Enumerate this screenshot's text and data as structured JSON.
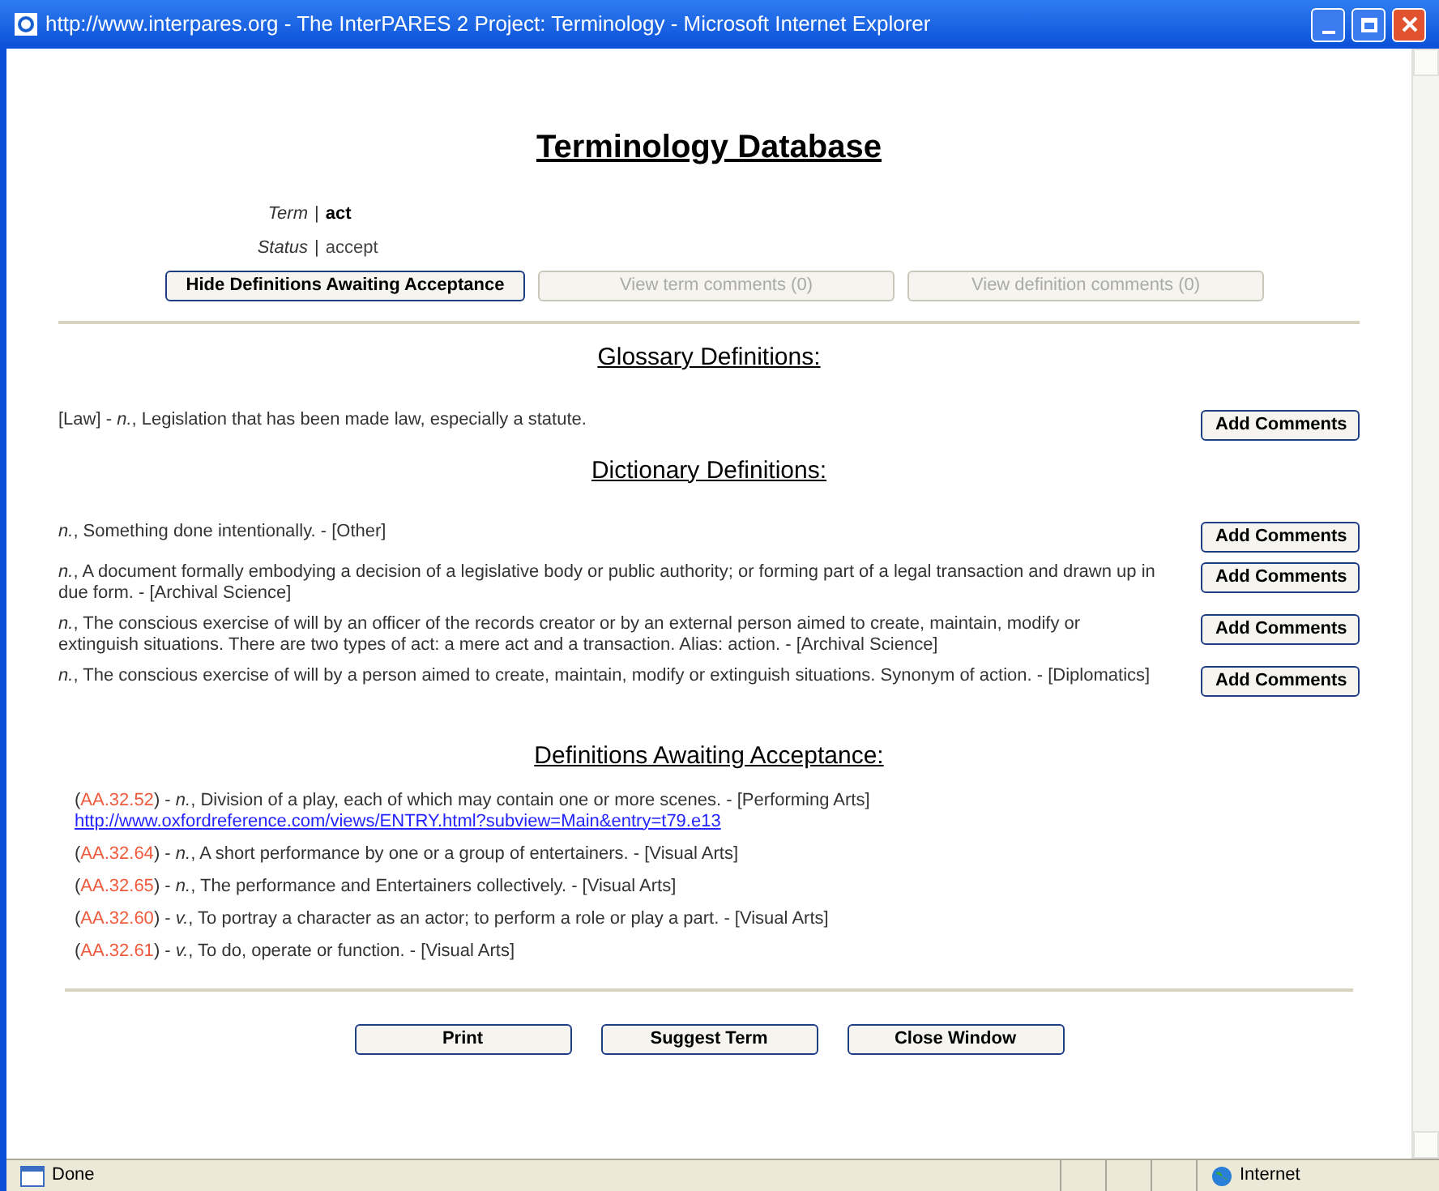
{
  "window": {
    "title": "http://www.interpares.org - The InterPARES 2 Project: Terminology - Microsoft Internet Explorer"
  },
  "page_title": "Terminology Database",
  "fields": [
    {
      "label": "Term",
      "separator": "|",
      "value": "act"
    },
    {
      "label": "Status",
      "separator": "|",
      "value": "accept"
    }
  ],
  "top_buttons": [
    {
      "label": "Hide Definitions Awaiting Acceptance",
      "disabled": false
    },
    {
      "label": "View term comments (0)",
      "disabled": true
    },
    {
      "label": "View definition comments (0)",
      "disabled": true
    }
  ],
  "glossary": {
    "heading": "Glossary Definitions:",
    "items": [
      {
        "text": "[Law] - *n.*, Legislation that has been made law, especially a statute.",
        "button": "Add Comments"
      }
    ]
  },
  "dictionary": {
    "heading": "Dictionary Definitions:",
    "items": [
      {
        "text": "*n.*, Something done intentionally. - [Other]",
        "button": "Add Comments"
      },
      {
        "text": "*n.*, A document formally embodying a decision of a legislative body or public authority; or forming part of a legal transaction and drawn up in due form. - [Archival Science]",
        "button": "Add Comments"
      },
      {
        "text": "*n.*, The conscious exercise of will by an officer of the records creator or by an external person aimed to create, maintain, modify or extinguish situations. There are two types of act: a mere act and a transaction. Alias: action. - [Archival Science]",
        "button": "Add Comments"
      },
      {
        "text": "*n.*, The conscious exercise of will by a person aimed to create, maintain, modify or extinguish situations. Synonym of action. - [Diplomatics]",
        "button": "Add Comments"
      }
    ]
  },
  "awaiting": {
    "heading": "Definitions Awaiting Acceptance:",
    "items": [
      {
        "open": "(",
        "code": "AA.32.52",
        "text": ") - *n.*, Division of a play, each of which may contain one or more scenes. - [Performing Arts]",
        "link": "http://www.oxfordreference.com/views/ENTRY.html?subview=Main&entry=t79.e13"
      },
      {
        "open": "(",
        "code": "AA.32.64",
        "text": ") - *n.*, A short performance by one or a group of entertainers. - [Visual Arts]"
      },
      {
        "open": "(",
        "code": "AA.32.65",
        "text": ") - *n.*, The performance and Entertainers collectively. - [Visual Arts]"
      },
      {
        "open": "(",
        "code": "AA.32.60",
        "text": ") - *v.*, To portray a character as an actor; to perform a role or play a part. - [Visual Arts]"
      },
      {
        "open": "(",
        "code": "AA.32.61",
        "text": ") - *v.*, To do, operate or function. - [Visual Arts]"
      }
    ]
  },
  "bottom_buttons": [
    "Print",
    "Suggest Term",
    "Close Window"
  ],
  "status_bar": {
    "text": "Done",
    "zone": "Internet"
  }
}
